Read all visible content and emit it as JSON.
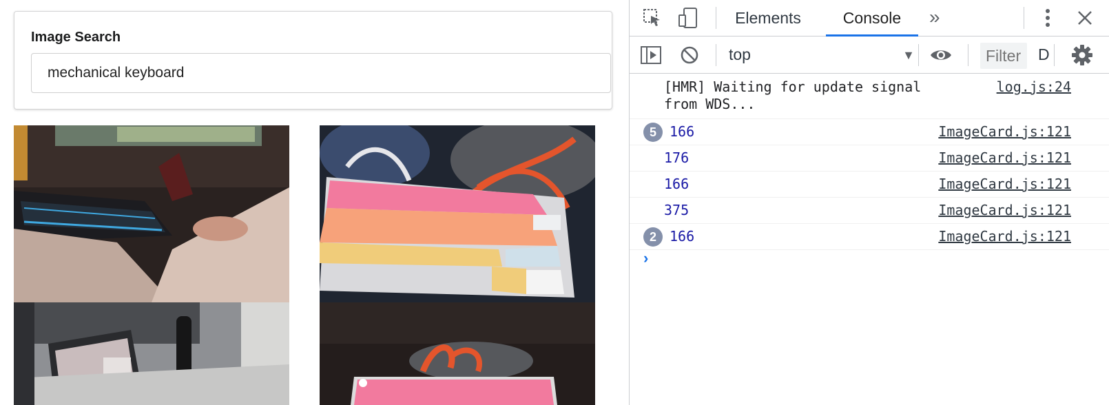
{
  "app": {
    "search": {
      "label": "Image Search",
      "value": "mechanical keyboard"
    },
    "images": [
      {
        "subject": "gaming setup with backlit keyboard"
      },
      {
        "subject": "pink and orange mechanical keyboard on sneakers"
      },
      {
        "subject": "laptop on desk with water bottle"
      },
      {
        "subject": "pink mechanical keyboard with sneaker"
      }
    ]
  },
  "devtools": {
    "tabs": [
      {
        "label": "Elements",
        "active": false
      },
      {
        "label": "Console",
        "active": true
      }
    ],
    "toolbar": {
      "context": "top",
      "filter_placeholder": "Filter",
      "levels": "D"
    },
    "logs": [
      {
        "message": "[HMR] Waiting for update signal from WDS...",
        "source": "log.js:24",
        "count": null
      },
      {
        "message": "166",
        "source": "ImageCard.js:121",
        "count": "5"
      },
      {
        "message": "176",
        "source": "ImageCard.js:121",
        "count": null
      },
      {
        "message": "166",
        "source": "ImageCard.js:121",
        "count": null
      },
      {
        "message": "375",
        "source": "ImageCard.js:121",
        "count": null
      },
      {
        "message": "166",
        "source": "ImageCard.js:121",
        "count": "2"
      }
    ],
    "prompt": "›",
    "colors": {
      "accent": "#1a73e8",
      "number": "#1a1aa6",
      "badge": "#8490aa"
    }
  }
}
